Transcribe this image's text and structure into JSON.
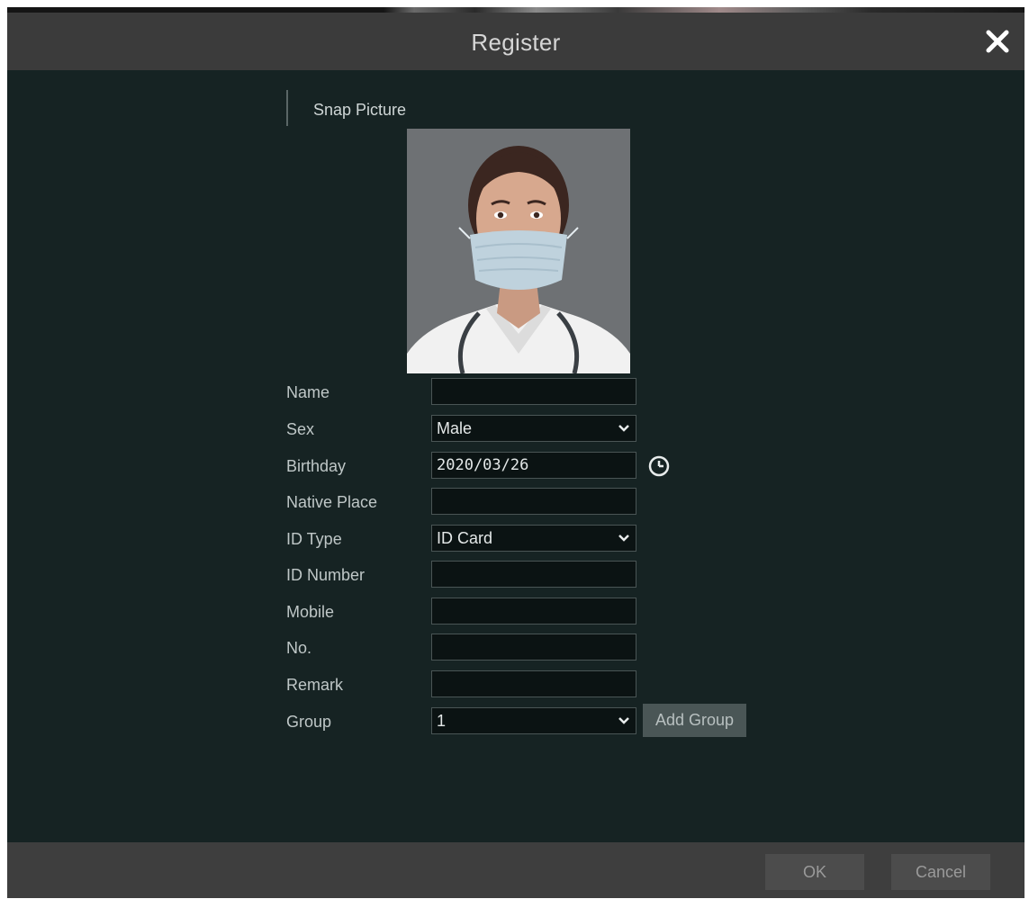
{
  "dialog": {
    "title": "Register"
  },
  "section": {
    "title": "Snap Picture"
  },
  "photo": {
    "description_icon": "person-photo"
  },
  "form": {
    "name": {
      "label": "Name",
      "value": ""
    },
    "sex": {
      "label": "Sex",
      "value": "Male"
    },
    "birthday": {
      "label": "Birthday",
      "value": "2020/03/26"
    },
    "native_place": {
      "label": "Native Place",
      "value": ""
    },
    "id_type": {
      "label": "ID Type",
      "value": "ID Card"
    },
    "id_number": {
      "label": "ID Number",
      "value": ""
    },
    "mobile": {
      "label": "Mobile",
      "value": ""
    },
    "no": {
      "label": "No.",
      "value": ""
    },
    "remark": {
      "label": "Remark",
      "value": ""
    },
    "group": {
      "label": "Group",
      "value": "1"
    },
    "add_group_label": "Add Group"
  },
  "footer": {
    "ok_label": "OK",
    "cancel_label": "Cancel"
  },
  "icons": {
    "close": "close-icon",
    "caret": "chevron-down-icon",
    "clock": "clock-icon"
  },
  "colors": {
    "dialog_bg": "#162323",
    "titlebar_bg": "#3b3b3b",
    "field_bg": "#0b1313",
    "field_border": "#4a5555",
    "footer_bg": "#3e3e3e"
  }
}
